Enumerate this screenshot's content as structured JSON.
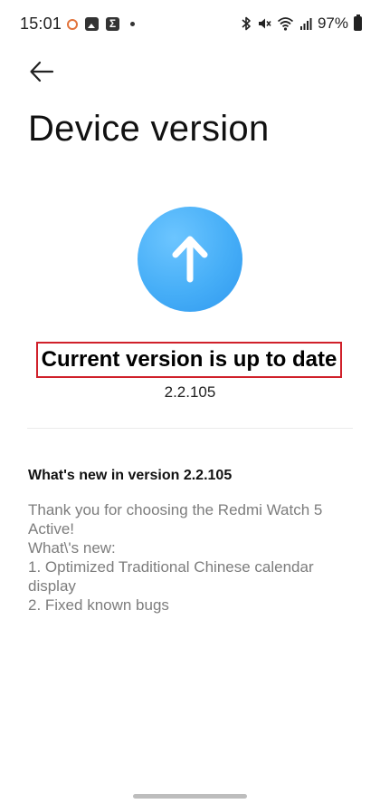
{
  "status_bar": {
    "time": "15:01",
    "battery_percent": "97%",
    "left_icons": [
      "ring-app-icon",
      "gallery-icon",
      "sigma-app-icon",
      "dot-icon"
    ],
    "right_icons": [
      "bluetooth-icon",
      "mute-icon",
      "wifi-icon",
      "signal-icon",
      "battery-icon"
    ]
  },
  "header": {
    "back_icon": "arrow-left-icon",
    "title": "Device version"
  },
  "update": {
    "icon": "arrow-up-icon",
    "circle_color": "#46aef7",
    "status_text": "Current version is up to date",
    "highlight_color": "#d0202a",
    "version": "2.2.105"
  },
  "whats_new": {
    "heading": "What's new in version 2.2.105",
    "notes": [
      "Thank you for choosing the Redmi Watch 5 Active!",
      "What\\'s new:",
      "1. Optimized Traditional Chinese calendar display",
      "2. Fixed known bugs"
    ]
  }
}
